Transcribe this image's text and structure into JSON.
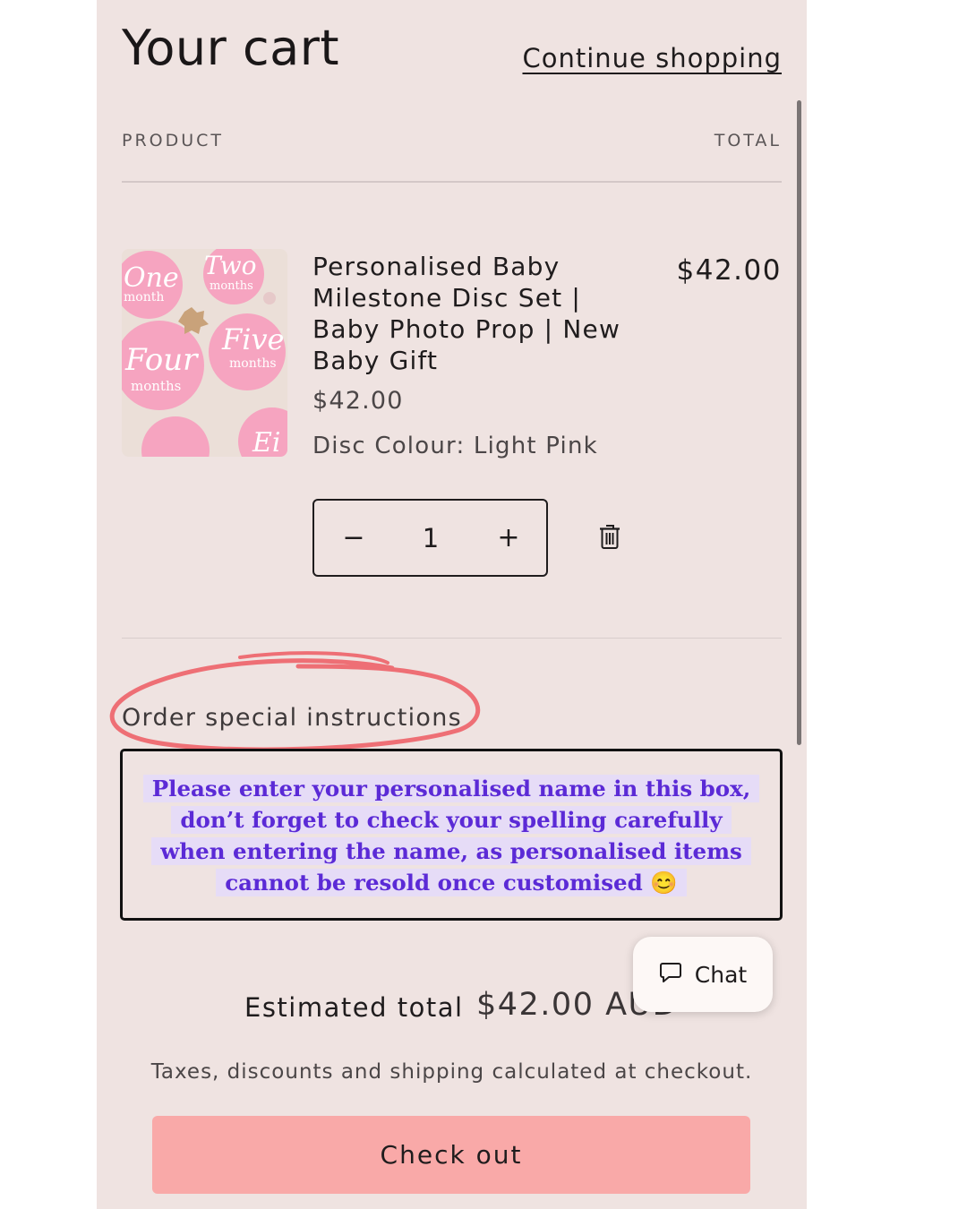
{
  "header": {
    "title": "Your cart",
    "continue_label": "Continue shopping"
  },
  "table": {
    "col_product": "PRODUCT",
    "col_total": "TOTAL"
  },
  "item": {
    "name": "Personalised Baby Milestone Disc Set | Baby Photo Prop | New Baby Gift",
    "price": "$42.00",
    "line_total": "$42.00",
    "variant": "Disc Colour: Light Pink",
    "quantity": "1",
    "minus_label": "−",
    "plus_label": "+",
    "image_discs": [
      "One",
      "month",
      "Two",
      "months",
      "Four",
      "months",
      "Five",
      "months",
      "Ei"
    ]
  },
  "instructions": {
    "label": "Order special instructions",
    "lines": [
      "Please enter your personalised name in this box,",
      "don’t forget to check your spelling carefully",
      "when entering the name, as personalised items",
      "cannot be resold once customised 😊"
    ]
  },
  "summary": {
    "estimated_label": "Estimated total",
    "estimated_value": "$42.00 AUD",
    "taxes_note": "Taxes, discounts and shipping calculated at checkout.",
    "checkout_label": "Check out"
  },
  "chat": {
    "label": "Chat"
  },
  "colors": {
    "page_bg": "#efe3e1",
    "checkout_bg": "#f9a9a8",
    "instruction_text": "#5b2ad6",
    "instruction_highlight": "#e6dcf7",
    "circle_annotation": "#ee6f75"
  }
}
